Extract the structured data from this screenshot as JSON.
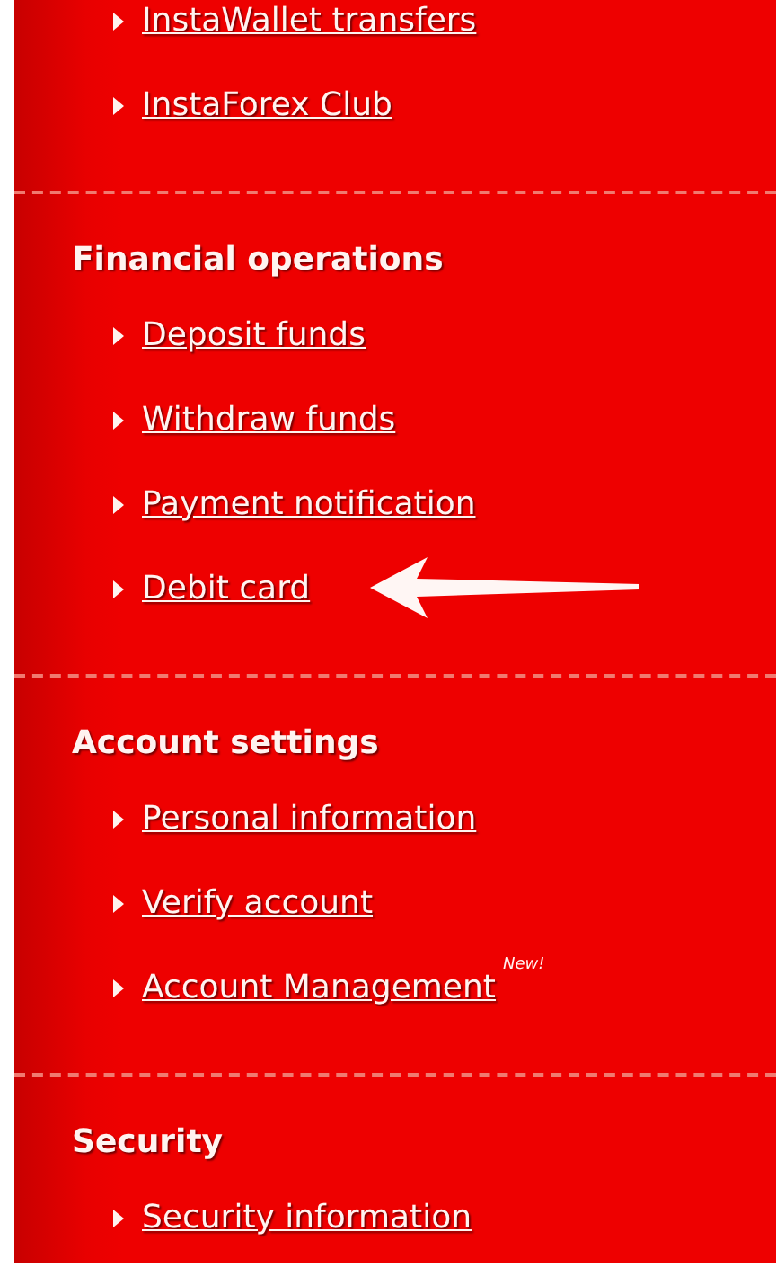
{
  "sections": [
    {
      "items": [
        {
          "label": "InstaWallet transfers",
          "arrow": false
        },
        {
          "label": "InstaForex Club",
          "arrow": false
        }
      ]
    },
    {
      "heading": "Financial operations",
      "items": [
        {
          "label": "Deposit funds",
          "arrow": false
        },
        {
          "label": "Withdraw funds",
          "arrow": false
        },
        {
          "label": "Payment notification",
          "arrow": false
        },
        {
          "label": "Debit card",
          "arrow": true
        }
      ]
    },
    {
      "heading": "Account settings",
      "items": [
        {
          "label": "Personal information",
          "arrow": false
        },
        {
          "label": "Verify account",
          "arrow": false
        },
        {
          "label": "Account Management",
          "badge": "New!",
          "arrow": false
        }
      ]
    },
    {
      "heading": "Security",
      "items": [
        {
          "label": "Security information",
          "arrow": false
        }
      ]
    }
  ]
}
